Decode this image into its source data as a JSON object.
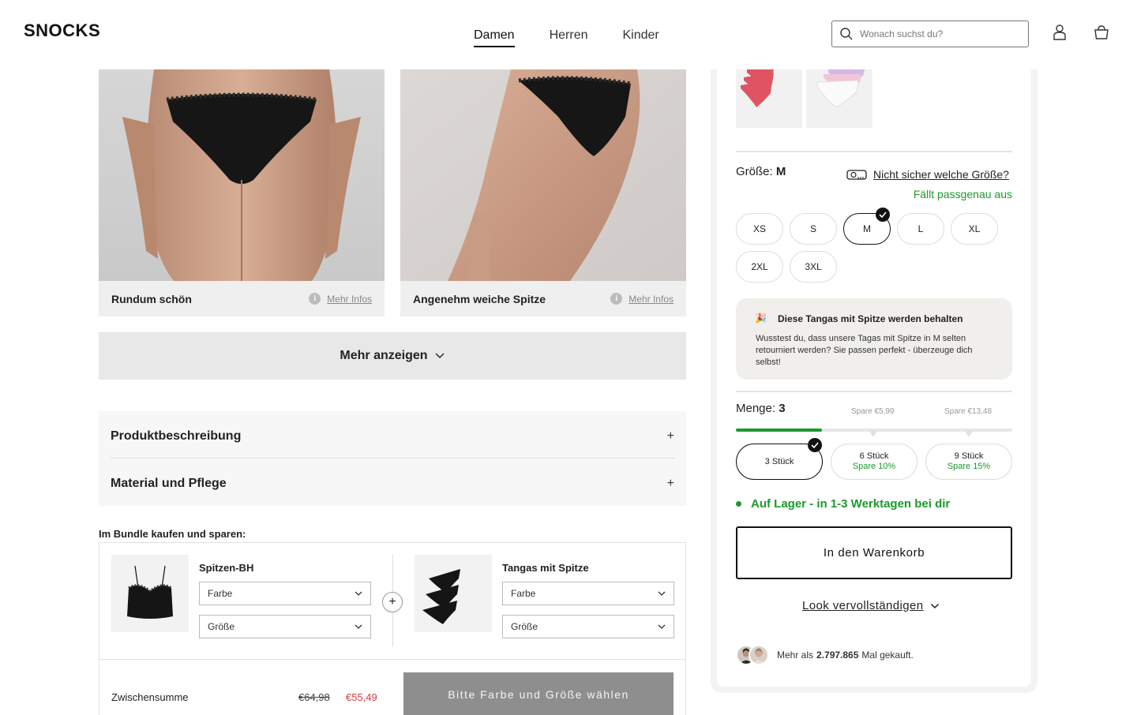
{
  "header": {
    "logo": "SNOCKS",
    "nav": [
      {
        "label": "Damen",
        "active": true
      },
      {
        "label": "Herren",
        "active": false
      },
      {
        "label": "Kinder",
        "active": false
      }
    ],
    "search_placeholder": "Wonach suchst du?",
    "icons": [
      "search-icon",
      "account-icon",
      "cart-icon"
    ]
  },
  "gallery": [
    {
      "caption": "Rundum schön",
      "info_label": "Mehr Infos"
    },
    {
      "caption": "Angenehm weiche Spitze",
      "info_label": "Mehr Infos"
    }
  ],
  "show_more_label": "Mehr anzeigen",
  "accordion": [
    {
      "label": "Produktbeschreibung"
    },
    {
      "label": "Material und Pflege"
    }
  ],
  "bundle": {
    "title": "Im Bundle kaufen und sparen:",
    "items": [
      {
        "name": "Spitzen-BH",
        "color_label": "Farbe",
        "size_label": "Größe"
      },
      {
        "name": "Tangas mit Spitze",
        "color_label": "Farbe",
        "size_label": "Größe"
      }
    ],
    "subtotal_label": "Zwischensumme",
    "old_price": "€64,98",
    "new_price": "€55,49",
    "cta": "Bitte Farbe und Größe wählen"
  },
  "product": {
    "size": {
      "label": "Größe:",
      "selected": "M",
      "help": "Nicht sicher welche Größe?",
      "fit": "Fällt passgenau aus",
      "options": [
        "XS",
        "S",
        "M",
        "L",
        "XL",
        "2XL",
        "3XL"
      ]
    },
    "info_box": {
      "emoji": "🎉",
      "title": "Diese Tangas mit Spitze werden behalten",
      "text": "Wusstest du, dass unsere Tagas mit Spitze in M selten retourniert werden? Sie passen perfekt - überzeuge dich selbst!"
    },
    "quantity": {
      "label": "Menge:",
      "selected": "3",
      "save_hints": [
        "Spare €5,99",
        "Spare €13,48"
      ],
      "progress": 0.31,
      "options": [
        {
          "label": "3 Stück",
          "save": "",
          "selected": true
        },
        {
          "label": "6 Stück",
          "save": "Spare 10%",
          "selected": false
        },
        {
          "label": "9 Stück",
          "save": "Spare 15%",
          "selected": false
        }
      ]
    },
    "stock": "Auf Lager - in 1-3 Werktagen bei dir",
    "add_to_cart": "In den Warenkorb",
    "complete_look": "Look vervollständigen",
    "social_proof": {
      "prefix": "Mehr als",
      "count": "2.797.865",
      "suffix": "Mal gekauft."
    }
  },
  "colors": {
    "accent_green": "#1b9a2b",
    "price_red": "#e0393e",
    "swatch_red": "#e05462",
    "swatch_lilac": "#d4b9e6"
  }
}
